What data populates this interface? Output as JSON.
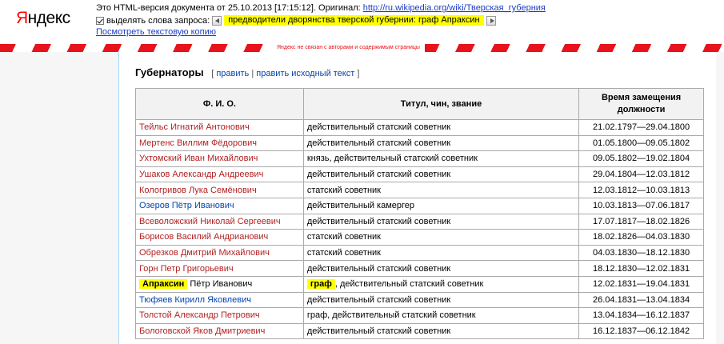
{
  "header": {
    "logo_ya": "Я",
    "logo_rest": "ндекс",
    "info_prefix": "Это HTML-версия документа от 25.10.2013 [17:15:12]. Оригинал: ",
    "original_url": "http://ru.wikipedia.org/wiki/Тверская_губерния",
    "highlight_label": "выделять слова запроса:",
    "query_text": "предводители дворянства тверской губернии: граф Апраксин",
    "text_copy_link": "Посмотреть текстовую копию"
  },
  "banner": {
    "disclaimer": "Яндекс не связан с авторами и содержимым страницы"
  },
  "section": {
    "title": "Губернаторы",
    "edit_open": "[",
    "edit_label": "править",
    "edit_sep": "|",
    "edit_source_label": "править исходный текст",
    "edit_close": "]"
  },
  "table": {
    "columns": [
      "Ф. И. О.",
      "Титул, чин, звание",
      "Время замещения должности"
    ],
    "rows": [
      {
        "name": "Тейльс Игнатий Антонович",
        "title": "действительный статский советник",
        "period": "21.02.1797—29.04.1800"
      },
      {
        "name": "Мертенс Виллим Фёдорович",
        "title": "действительный статский советник",
        "period": "01.05.1800—09.05.1802"
      },
      {
        "name": "Ухтомский Иван Михайлович",
        "title": "князь, действительный статский советник",
        "period": "09.05.1802—19.02.1804"
      },
      {
        "name": "Ушаков Александр Андреевич",
        "title": "действительный статский советник",
        "period": "29.04.1804—12.03.1812"
      },
      {
        "name": "Кологривов Лука Семёнович",
        "title": "статский советник",
        "period": "12.03.1812—10.03.1813"
      },
      {
        "name": "Озеров Пётр Иванович",
        "title": "действительный камергер",
        "period": "10.03.1813—07.06.1817"
      },
      {
        "name": "Всеволожский Николай Сергеевич",
        "title": "действительный статский советник",
        "period": "17.07.1817—18.02.1826"
      },
      {
        "name": "Борисов Василий Андрианович",
        "title": "статский советник",
        "period": "18.02.1826—04.03.1830"
      },
      {
        "name": "Обрезков Дмитрий Михайлович",
        "title": "статский советник",
        "period": "04.03.1830—18.12.1830"
      },
      {
        "name": "Горн Петр Григорьевич",
        "title": "действительный статский советник",
        "period": "18.12.1830—12.02.1831"
      },
      {
        "name_hl": "Апраксин",
        "name_rest": " Пётр Иванович",
        "title_hl": "граф",
        "title_rest": ", действительный статский советник",
        "period": "12.02.1831—19.04.1831"
      },
      {
        "name": "Тюфяев Кирилл Яковлевич",
        "title": "действительный статский советник",
        "period": "26.04.1831—13.04.1834"
      },
      {
        "name": "Толстой Александр Петрович",
        "title": "граф, действительный статский советник",
        "period": "13.04.1834—16.12.1837"
      },
      {
        "name": "Бологовской Яков Дмитриевич",
        "title": "действительный статский советник",
        "period": "16.12.1837—06.12.1842"
      }
    ]
  },
  "colors": {
    "stripe_red": "#e8121b",
    "link_red": "#b22222",
    "link_blue": "#0645ad",
    "highlight": "#ffff00"
  }
}
